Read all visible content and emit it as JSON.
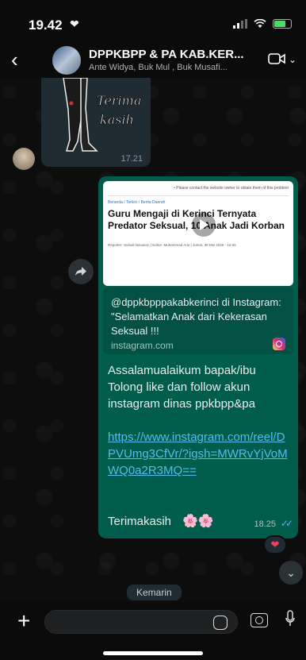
{
  "status": {
    "time": "19.42",
    "heart": "❤"
  },
  "header": {
    "title": "DPPKBPP & PA KAB.KER...",
    "subtitle": "Ante Widya, Buk Mul , Buk Musafi..."
  },
  "sticker_message": {
    "time": "17.21",
    "sticker_text_1": "Terima",
    "sticker_text_2": "kasih"
  },
  "main_message": {
    "preview": {
      "top_note": "• Please contact the website owner to obtain them of this problem",
      "breadcrumb": "Beranda / Terkini / Berita Daerah",
      "headline": "Guru Mengaji di Kerinci Ternyata Predator Seksual, 10 Anak Jadi Korban",
      "meta": "Reporter: Suhaili Nasution  |  Editor: Muhammad Arie  |  Jumat, 30 Mei 2025 - 16:55"
    },
    "link_card": {
      "text": "@dppkbpppakabkerinci di Instagram: \"Selamatkan Anak dari Kekerasan Seksual !!!",
      "domain": "instagram.com"
    },
    "body": "Assalamualaikum bapak/ibu Tolong like dan follow akun instagram dinas ppkbpp&pa",
    "url": "https://www.instagram.com/reel/DPVUmg3CfVr/?igsh=MWRvYjVoMWQ0a2R3MQ==",
    "closing": "Terimakasih",
    "flowers": "🌸🌸",
    "time": "18.25",
    "ticks": "✓✓"
  },
  "reaction": "❤",
  "date_chip": "Kemarin",
  "colors": {
    "bubble_out": "#005c4b",
    "bubble_in": "#1f2c33",
    "link": "#53bdeb"
  }
}
